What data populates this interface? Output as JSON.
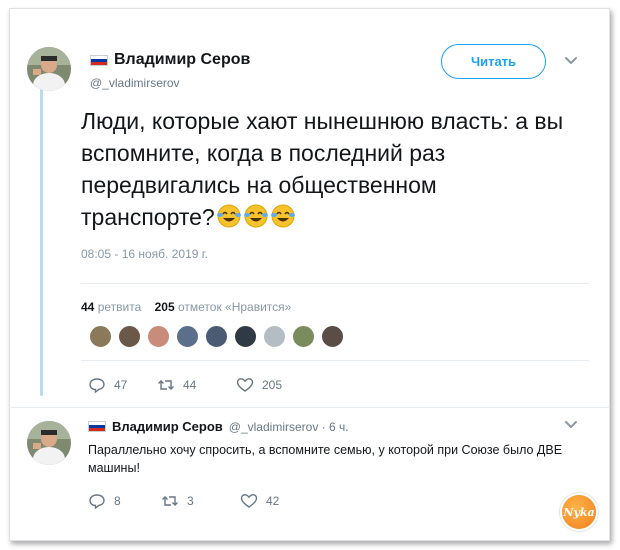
{
  "tweet": {
    "author_name": "Владимир Серов",
    "author_handle": "@_vladimirserov",
    "follow_label": "Читать",
    "text": "Люди, которые хают нынешнюю власть: а вы вспомните, когда в последний раз передвигались на общественном транспорте?",
    "emojis": [
      "rolling-on-floor-laughing",
      "rolling-on-floor-laughing",
      "rolling-on-floor-laughing"
    ],
    "timestamp": "08:05 - 16 нояб. 2019 г.",
    "retweets_count": "44",
    "retweets_label": "ретвита",
    "likes_count": "205",
    "likes_label": "отметок «Нравится»",
    "actions": {
      "replies": "47",
      "retweets": "44",
      "likes": "205"
    }
  },
  "reply": {
    "author_name": "Владимир Серов",
    "author_handle": "@_vladimirserov · 6 ч.",
    "text": "Параллельно хочу спросить, а вспомните семью, у которой при Союзе было ДВЕ машины!",
    "actions": {
      "replies": "8",
      "retweets": "3",
      "likes": "42"
    }
  },
  "watermark": {
    "text": "Nyka"
  },
  "colors": {
    "accent": "#1da1f2",
    "thread_line": "#b9dcf3",
    "muted": "#657786"
  }
}
